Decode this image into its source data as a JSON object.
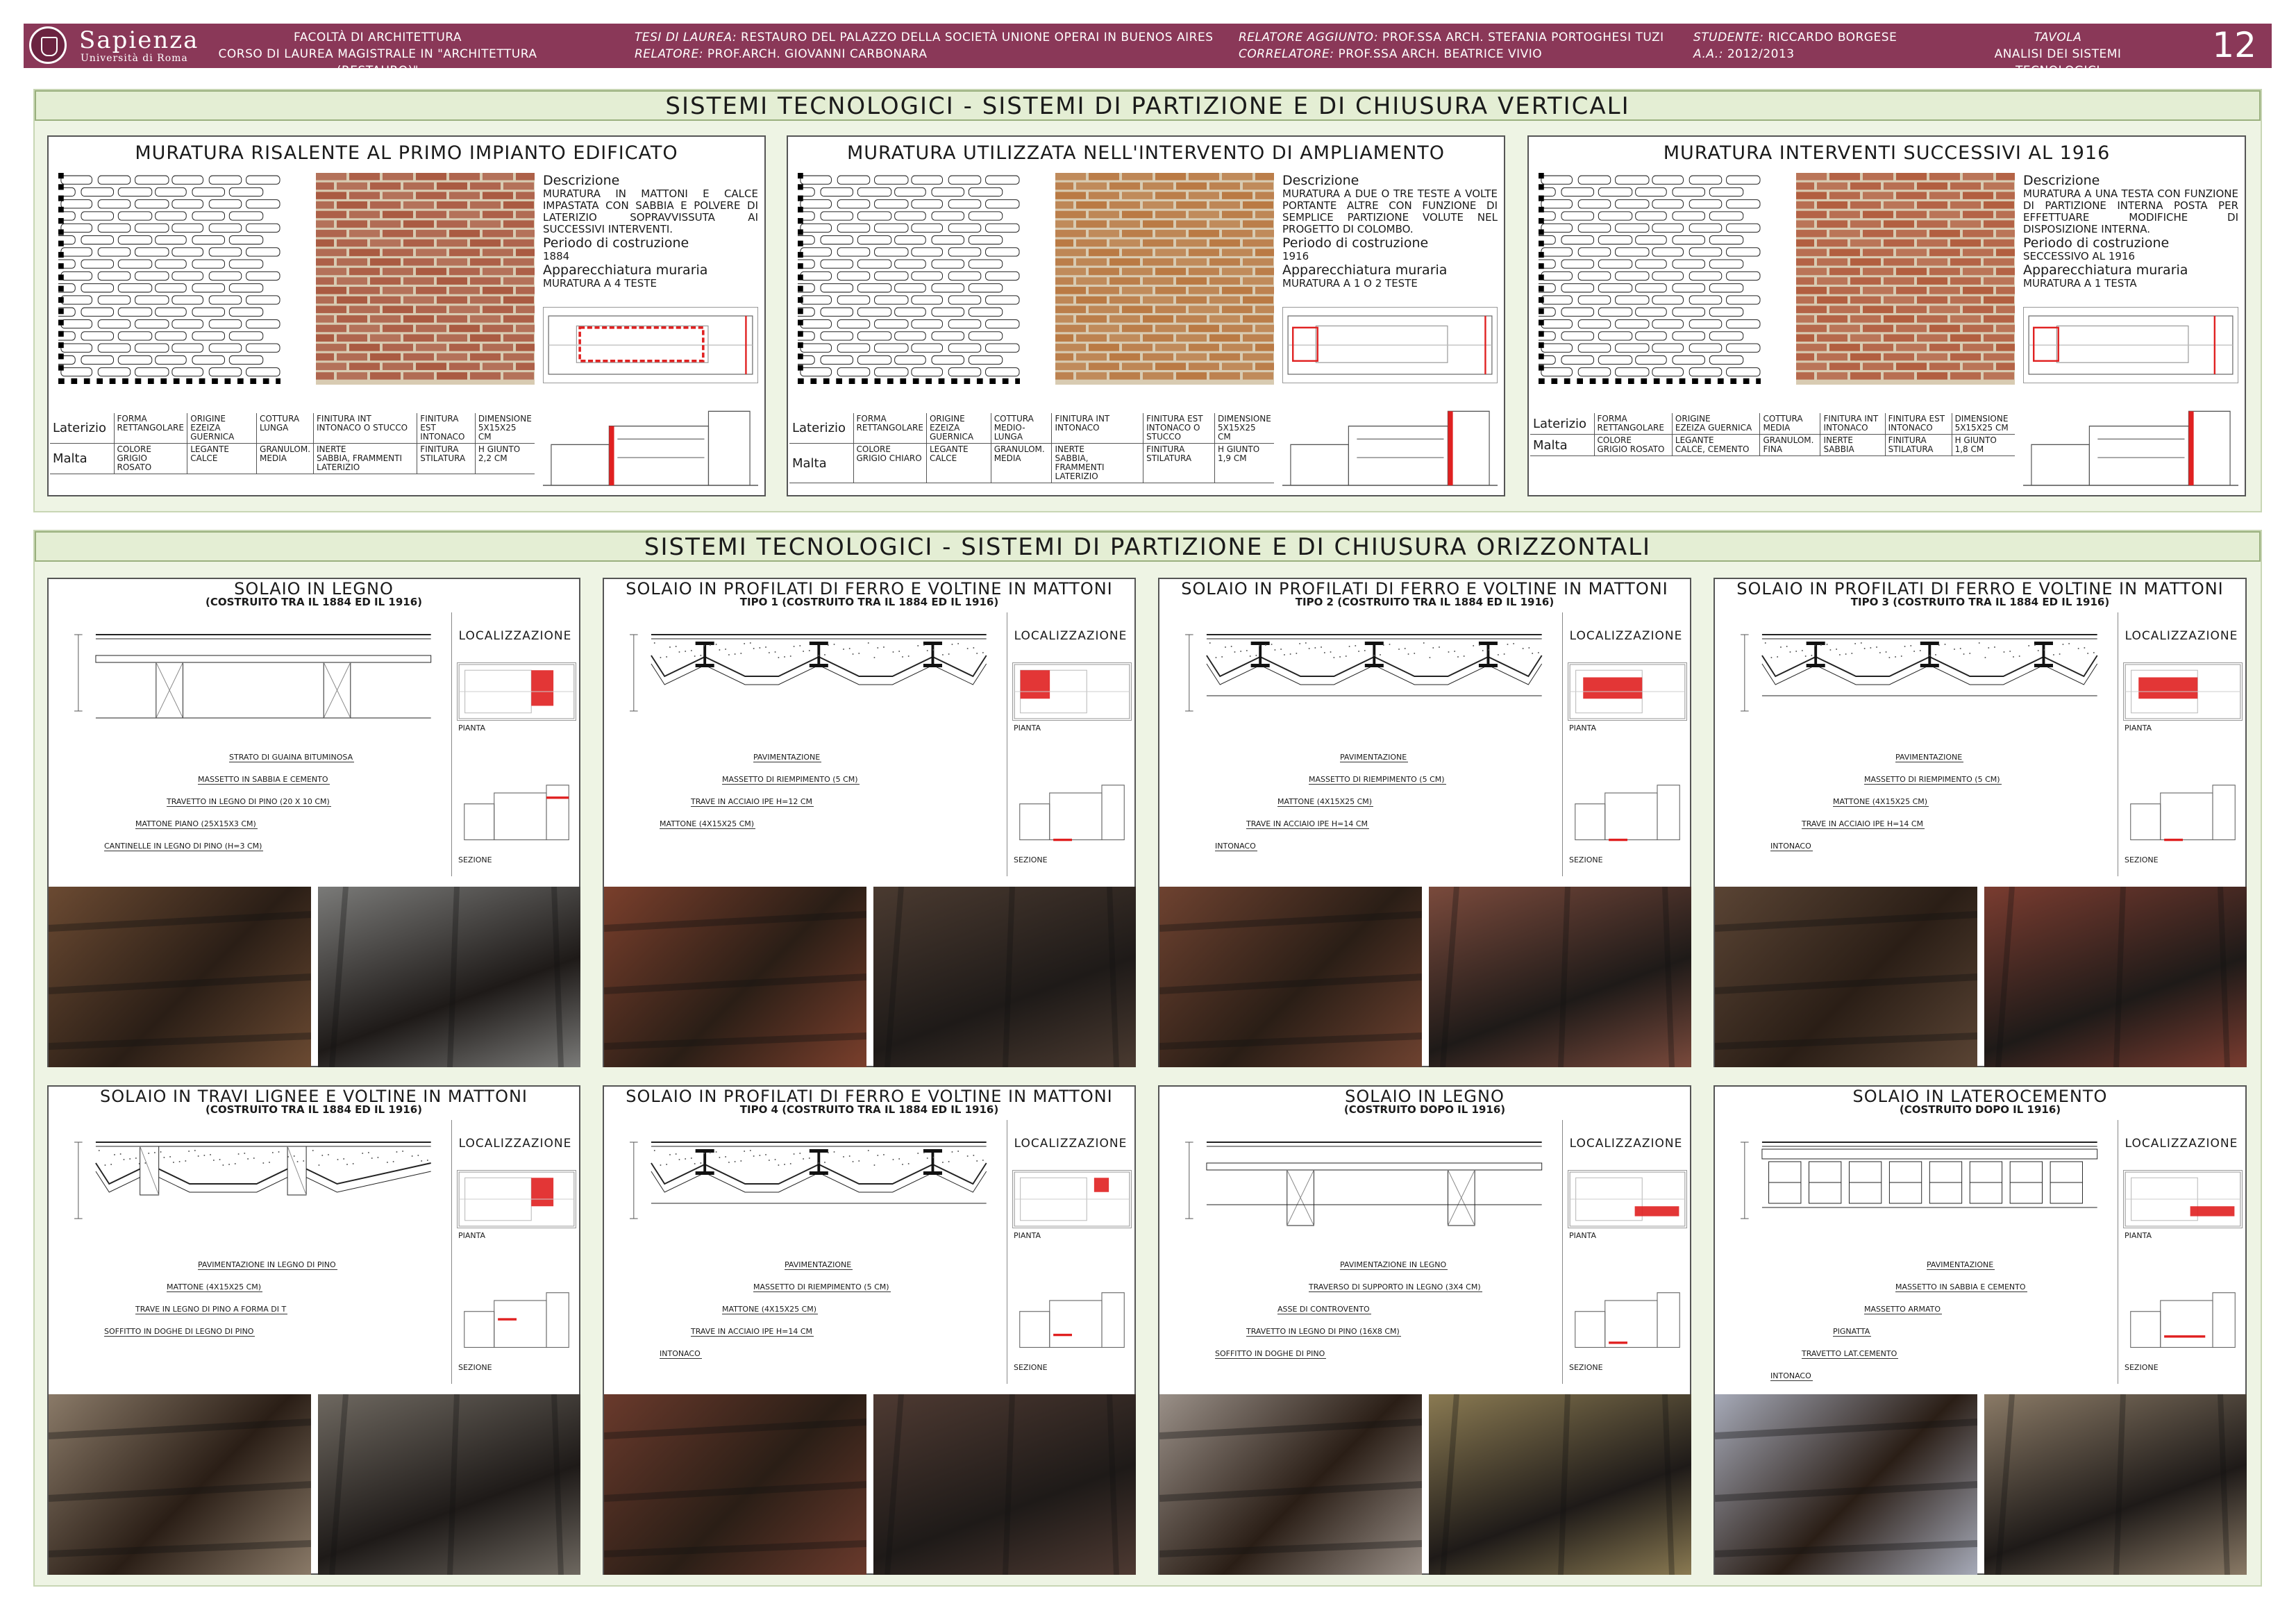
{
  "header": {
    "university": "Sapienza",
    "university_sub": "Università di Roma",
    "faculty": "Facoltà di Architettura",
    "course": "Corso di Laurea Magistrale in \"Architettura (Restauro)\"",
    "thesis_label": "Tesi di Laurea:",
    "thesis": "Restauro del palazzo della società unione operai in Buenos Aires",
    "relatore_label": "Relatore:",
    "relatore": "Prof.Arch. Giovanni Carbonara",
    "relatore_agg_label": "Relatore aggiunto:",
    "relatore_agg": "Prof.ssa Arch. Stefania Portoghesi Tuzi",
    "correlatore_label": "Correlatore:",
    "correlatore": "Prof.ssa Arch. Beatrice Vivio",
    "studente_label": "Studente:",
    "studente": "Riccardo Borgese",
    "aa_label": "A.A.:",
    "aa": "2012/2013",
    "tavola_label": "Tavola",
    "tavola": "Analisi dei sistemi tecnologici",
    "number": "12"
  },
  "vertical": {
    "title": "Sistemi tecnologici - sistemi di partizione e di chiusura verticali",
    "cards": [
      {
        "title": "Muratura risalente al primo impianto edificato",
        "desc_h": "Descrizione",
        "desc": "Muratura in mattoni e calce impastata con sabbia e polvere di laterizio sopravvissuta ai successivi interventi.",
        "period_h": "Periodo di costruzione",
        "period": "1884",
        "app_h": "Apparecchiatura muraria",
        "app": "Muratura a 4 teste",
        "brick_color": "#a8543c",
        "lat": [
          "Laterizio",
          "Forma",
          "Rettangolare",
          "Origine",
          "Ezeiza Guernica",
          "Cottura",
          "Lunga",
          "Finitura int",
          "Intonaco o stucco",
          "Finitura est",
          "Intonaco",
          "Dimensione",
          "5x15x25 cm"
        ],
        "mal": [
          "Malta",
          "Colore",
          "Grigio rosato",
          "Legante",
          "Calce",
          "Granulom.",
          "Media",
          "Inerte",
          "Sabbia, frammenti laterizio",
          "Finitura",
          "Stilatura",
          "H giunto",
          "2,2 cm"
        ]
      },
      {
        "title": "Muratura utilizzata nell'intervento di ampliamento",
        "desc_h": "Descrizione",
        "desc": "Muratura a due o tre teste a volte portante altre con funzione di semplice partizione volute nel progetto di Colombo.",
        "period_h": "Periodo di costruzione",
        "period": "1916",
        "app_h": "Apparecchiatura muraria",
        "app": "Muratura a 1 o 2 teste",
        "brick_color": "#b8753e",
        "lat": [
          "Laterizio",
          "Forma",
          "Rettangolare",
          "Origine",
          "Ezeiza Guernica",
          "Cottura",
          "Medio-lunga",
          "Finitura int",
          "Intonaco",
          "Finitura est",
          "Intonaco o stucco",
          "Dimensione",
          "5x15x25 cm"
        ],
        "mal": [
          "Malta",
          "Colore",
          "Grigio chiaro",
          "Legante",
          "Calce",
          "Granulom.",
          "Media",
          "Inerte",
          "Sabbia, frammenti laterizio",
          "Finitura",
          "Stilatura",
          "H giunto",
          "1,9 cm"
        ]
      },
      {
        "title": "Muratura interventi successivi al 1916",
        "desc_h": "Descrizione",
        "desc": "Muratura a una testa con funzione di partizione interna posta per effettuare modifiche di disposizione interna.",
        "period_h": "Periodo di costruzione",
        "period": "Seccessivo al 1916",
        "app_h": "Apparecchiatura muraria",
        "app": "Muratura a 1 testa",
        "brick_color": "#b0583a",
        "lat": [
          "Laterizio",
          "Forma",
          "Rettangolare",
          "Origine",
          "Ezeiza Guernica",
          "Cottura",
          "Media",
          "Finitura int",
          "Intonaco",
          "Finitura est",
          "Intonaco",
          "Dimensione",
          "5x15x25 cm"
        ],
        "mal": [
          "Malta",
          "Colore",
          "Grigio rosato",
          "Legante",
          "Calce, cemento",
          "Granulom.",
          "Fina",
          "Inerte",
          "Sabbia",
          "Finitura",
          "Stilatura",
          "H giunto",
          "1,8 cm"
        ]
      }
    ]
  },
  "horizontal": {
    "title": "Sistemi tecnologici - sistemi di partizione e di chiusura orizzontali",
    "loc_title": "Localizzazione",
    "pianta": "Pianta",
    "sezione": "Sezione",
    "cards": [
      {
        "title": "Solaio in legno",
        "sub": "(costruito tra il 1884 ed il 1916)",
        "labels": [
          "Strato di guaina bituminosa",
          "Massetto in sabbia e cemento",
          "Travetto in legno di pino (20 x 10 cm)",
          "Mattone piano (25x15x3 cm)",
          "Cantinelle in legno di pino (h=3 cm)"
        ],
        "photos": [
          "#6b4a32",
          "#7a7a78"
        ]
      },
      {
        "title": "Solaio in profilati di ferro e voltine in mattoni",
        "sub": "Tipo 1 (costruito tra il 1884 ed il 1916)",
        "labels": [
          "Pavimentazione",
          "Massetto di riempimento (5 cm)",
          "Trave in acciaio IPE h=12 cm",
          "Mattone (4x15x25 cm)"
        ],
        "photos": [
          "#7a3f2c",
          "#4a3a30"
        ]
      },
      {
        "title": "Solaio in profilati di ferro e voltine in mattoni",
        "sub": "Tipo 2 (costruito tra il 1884 ed il 1916)",
        "labels": [
          "Pavimentazione",
          "Massetto di riempimento (5 cm)",
          "Mattone (4x15x25 cm)",
          "Trave in acciaio IPE h=14 cm",
          "Intonaco"
        ],
        "photos": [
          "#6e4230",
          "#7a4a3c"
        ]
      },
      {
        "title": "Solaio in profilati di ferro e voltine in mattoni",
        "sub": "Tipo 3 (costruito tra il 1884 ed il 1916)",
        "labels": [
          "Pavimentazione",
          "Massetto di riempimento (5 cm)",
          "Mattone (4x15x25 cm)",
          "Trave in acciaio IPE h=14 cm",
          "Intonaco"
        ],
        "photos": [
          "#5a4434",
          "#7a3c30"
        ]
      },
      {
        "title": "Solaio in travi lignee e voltine in mattoni",
        "sub": "(costruito tra il 1884 ed il 1916)",
        "labels": [
          "Pavimentazione in legno di pino",
          "Mattone (4x15x25 cm)",
          "Trave in legno di pino a forma di T",
          "Soffitto in doghe di legno di pino"
        ],
        "photos": [
          "#8a7a68",
          "#6e6860"
        ]
      },
      {
        "title": "Solaio in profilati di ferro e voltine in mattoni",
        "sub": "Tipo 4 (costruito tra il 1884 ed il 1916)",
        "labels": [
          "Pavimentazione",
          "Massetto di riempimento (5 cm)",
          "Mattone (4x15x25 cm)",
          "Trave in acciaio IPE h=14 cm",
          "Intonaco"
        ],
        "photos": [
          "#6a3a2c",
          "#4e3a32"
        ]
      },
      {
        "title": "Solaio in legno",
        "sub": "(costruito dopo il 1916)",
        "labels": [
          "Pavimentazione in legno",
          "Traverso di supporto in legno (3x4 cm)",
          "Asse di controvento",
          "Travetto in legno di pino (16x8 cm)",
          "Soffitto in doghe di pino"
        ],
        "photos": [
          "#9a9088",
          "#8a7a52"
        ]
      },
      {
        "title": "Solaio in laterocemento",
        "sub": "(costruito dopo il 1916)",
        "labels": [
          "Pavimentazione",
          "Massetto in sabbia e cemento",
          "Massetto armato",
          "Pignatta",
          "Travetto lat.cemento",
          "Intonaco"
        ],
        "photos": [
          "#a6aab8",
          "#8a7a66"
        ]
      }
    ]
  },
  "colors": {
    "header_bg": "#8a3858",
    "panel_bg": "#eef4e4",
    "highlight_red": "#e02020"
  }
}
